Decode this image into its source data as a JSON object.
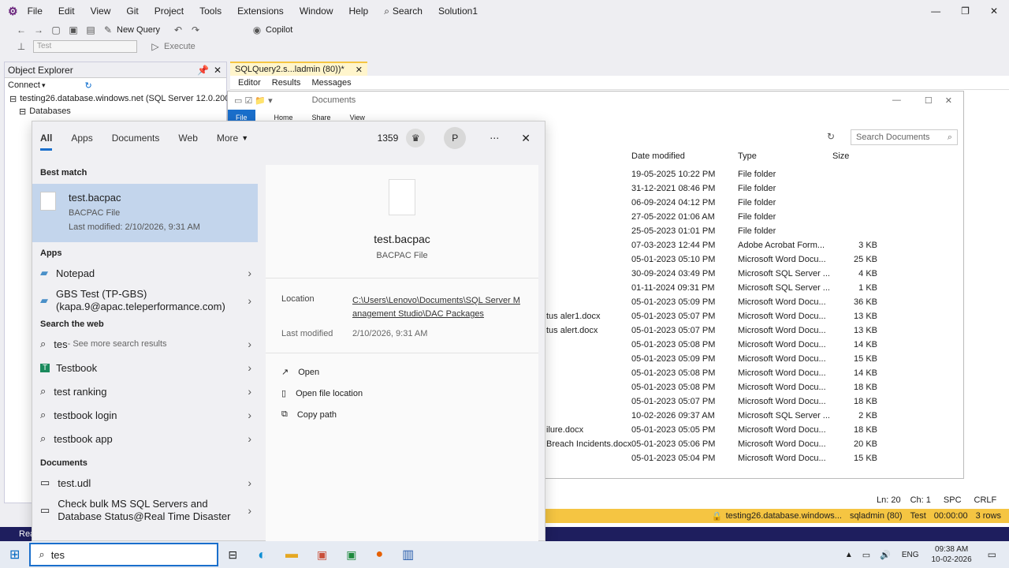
{
  "ssms": {
    "menu": [
      "File",
      "Edit",
      "View",
      "Git",
      "Project",
      "Tools",
      "Extensions",
      "Window",
      "Help"
    ],
    "search_label": "Search",
    "solution": "Solution1",
    "new_query": "New Query",
    "copilot": "Copilot",
    "db_selector": "Test",
    "execute": "Execute",
    "oe_title": "Object Explorer",
    "connect": "Connect",
    "server_node": "testing26.database.windows.net (SQL Server 12.0.2000.8 -",
    "databases_node": "Databases",
    "query_tab": "SQLQuery2.s...ladmin (80))*",
    "result_tabs": [
      "Editor",
      "Results",
      "Messages"
    ],
    "cursor_pos": {
      "ln": "Ln: 20",
      "ch": "Ch: 1",
      "spc": "SPC",
      "crlf": "CRLF"
    },
    "status": {
      "server": "testing26.database.windows...",
      "user": "sqladmin (80)",
      "db": "Test",
      "time": "00:00:00",
      "rows": "3 rows"
    },
    "statusbar_left": "Rea"
  },
  "explorer": {
    "path": "Documents",
    "ribbon": [
      "File",
      "Home",
      "Share",
      "View"
    ],
    "search_placeholder": "Search Documents",
    "columns": [
      "Date modified",
      "Type",
      "Size"
    ],
    "rows": [
      {
        "name": "",
        "date": "19-05-2025 10:22 PM",
        "type": "File folder",
        "size": ""
      },
      {
        "name": "",
        "date": "31-12-2021 08:46 PM",
        "type": "File folder",
        "size": ""
      },
      {
        "name": "",
        "date": "06-09-2024 04:12 PM",
        "type": "File folder",
        "size": ""
      },
      {
        "name": "",
        "date": "27-05-2022 01:06 AM",
        "type": "File folder",
        "size": ""
      },
      {
        "name": "",
        "date": "25-05-2023 01:01 PM",
        "type": "File folder",
        "size": ""
      },
      {
        "name": "",
        "date": "07-03-2023 12:44 PM",
        "type": "Adobe Acrobat Form...",
        "size": "3 KB"
      },
      {
        "name": "",
        "date": "05-01-2023 05:10 PM",
        "type": "Microsoft Word Docu...",
        "size": "25 KB"
      },
      {
        "name": "",
        "date": "30-09-2024 03:49 PM",
        "type": "Microsoft SQL Server ...",
        "size": "4 KB"
      },
      {
        "name": "",
        "date": "01-11-2024 09:31 PM",
        "type": "Microsoft SQL Server ...",
        "size": "1 KB"
      },
      {
        "name": "",
        "date": "05-01-2023 05:09 PM",
        "type": "Microsoft Word Docu...",
        "size": "36 KB"
      },
      {
        "name": "tus aler1.docx",
        "date": "05-01-2023 05:07 PM",
        "type": "Microsoft Word Docu...",
        "size": "13 KB"
      },
      {
        "name": "tus alert.docx",
        "date": "05-01-2023 05:07 PM",
        "type": "Microsoft Word Docu...",
        "size": "13 KB"
      },
      {
        "name": "",
        "date": "05-01-2023 05:08 PM",
        "type": "Microsoft Word Docu...",
        "size": "14 KB"
      },
      {
        "name": "",
        "date": "05-01-2023 05:09 PM",
        "type": "Microsoft Word Docu...",
        "size": "15 KB"
      },
      {
        "name": "",
        "date": "05-01-2023 05:08 PM",
        "type": "Microsoft Word Docu...",
        "size": "14 KB"
      },
      {
        "name": "",
        "date": "05-01-2023 05:08 PM",
        "type": "Microsoft Word Docu...",
        "size": "18 KB"
      },
      {
        "name": "",
        "date": "05-01-2023 05:07 PM",
        "type": "Microsoft Word Docu...",
        "size": "18 KB"
      },
      {
        "name": "",
        "date": "10-02-2026 09:37 AM",
        "type": "Microsoft SQL Server ...",
        "size": "2 KB"
      },
      {
        "name": "ilure.docx",
        "date": "05-01-2023 05:05 PM",
        "type": "Microsoft Word Docu...",
        "size": "18 KB"
      },
      {
        "name": "Breach Incidents.docx",
        "date": "05-01-2023 05:06 PM",
        "type": "Microsoft Word Docu...",
        "size": "20 KB"
      },
      {
        "name": "",
        "date": "05-01-2023 05:04 PM",
        "type": "Microsoft Word Docu...",
        "size": "15 KB"
      }
    ]
  },
  "search": {
    "tabs": [
      "All",
      "Apps",
      "Documents",
      "Web",
      "More"
    ],
    "points": "1359",
    "avatar": "P",
    "best_match_label": "Best match",
    "best": {
      "name": "test.bacpac",
      "type": "BACPAC File",
      "modified": "Last modified: 2/10/2026, 9:31 AM"
    },
    "apps_label": "Apps",
    "apps": [
      "Notepad",
      "GBS Test (TP-GBS)\n(kapa.9@apac.teleperformance.com)"
    ],
    "web_label": "Search the web",
    "web_first": {
      "q": "tes",
      "suffix": " - See more search results"
    },
    "web": [
      "Testbook",
      "test ranking",
      "testbook login",
      "testbook app"
    ],
    "docs_label": "Documents",
    "docs": [
      "test.udl",
      "Check bulk MS SQL Servers and\nDatabase Status@Real Time Disaster"
    ],
    "preview": {
      "name": "test.bacpac",
      "type": "BACPAC File",
      "location_label": "Location",
      "location": "C:\\Users\\Lenovo\\Documents\\SQL Server Management Studio\\DAC Packages",
      "modified_label": "Last modified",
      "modified": "2/10/2026, 9:31 AM",
      "actions": [
        "Open",
        "Open file location",
        "Copy path"
      ]
    },
    "query": "tes"
  },
  "taskbar": {
    "lang": "ENG",
    "time": "09:38 AM",
    "date": "10-02-2026"
  }
}
